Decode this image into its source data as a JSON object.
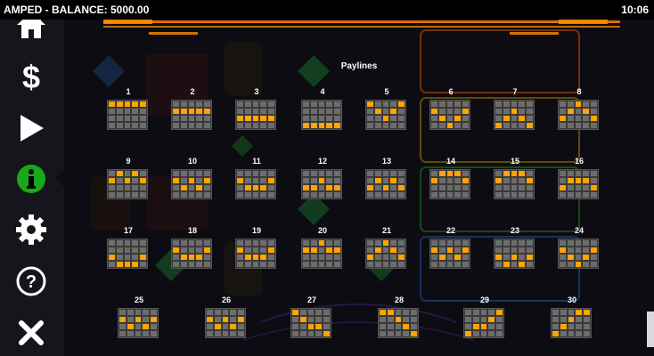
{
  "topbar": {
    "title": "AMPED - BALANCE: 5000.00",
    "clock": "10:06"
  },
  "sidebar": {
    "items": [
      {
        "icon": "home-icon",
        "active": false
      },
      {
        "icon": "dollar-icon",
        "active": false
      },
      {
        "icon": "play-icon",
        "active": false
      },
      {
        "icon": "info-icon",
        "active": true
      },
      {
        "icon": "gear-icon",
        "active": false
      },
      {
        "icon": "help-icon",
        "active": false
      },
      {
        "icon": "close-icon",
        "active": false
      }
    ],
    "active_color": "#19a81a"
  },
  "paytable": {
    "title": "Paylines",
    "grid_rows": 4,
    "grid_cols": 5,
    "paylines": [
      {
        "n": "1",
        "rows": [
          0,
          0,
          0,
          0,
          0
        ]
      },
      {
        "n": "2",
        "rows": [
          1,
          1,
          1,
          1,
          1
        ]
      },
      {
        "n": "3",
        "rows": [
          2,
          2,
          2,
          2,
          2
        ]
      },
      {
        "n": "4",
        "rows": [
          3,
          3,
          3,
          3,
          3
        ]
      },
      {
        "n": "5",
        "rows": [
          0,
          1,
          2,
          1,
          0
        ]
      },
      {
        "n": "6",
        "rows": [
          1,
          2,
          3,
          2,
          1
        ]
      },
      {
        "n": "7",
        "rows": [
          3,
          2,
          1,
          2,
          3
        ]
      },
      {
        "n": "8",
        "rows": [
          2,
          1,
          0,
          1,
          2
        ]
      },
      {
        "n": "9",
        "rows": [
          1,
          0,
          1,
          0,
          1
        ]
      },
      {
        "n": "10",
        "rows": [
          1,
          2,
          1,
          2,
          1
        ]
      },
      {
        "n": "11",
        "rows": [
          1,
          2,
          2,
          2,
          1
        ]
      },
      {
        "n": "12",
        "rows": [
          2,
          2,
          1,
          2,
          2
        ]
      },
      {
        "n": "13",
        "rows": [
          2,
          1,
          2,
          1,
          2
        ]
      },
      {
        "n": "14",
        "rows": [
          1,
          0,
          0,
          0,
          1
        ]
      },
      {
        "n": "15",
        "rows": [
          1,
          0,
          0,
          0,
          1
        ]
      },
      {
        "n": "16",
        "rows": [
          2,
          1,
          1,
          1,
          2
        ]
      },
      {
        "n": "17",
        "rows": [
          2,
          3,
          3,
          3,
          2
        ]
      },
      {
        "n": "18",
        "rows": [
          1,
          2,
          2,
          2,
          1
        ]
      },
      {
        "n": "19",
        "rows": [
          1,
          2,
          2,
          2,
          1
        ]
      },
      {
        "n": "20",
        "rows": [
          1,
          1,
          0,
          1,
          1
        ]
      },
      {
        "n": "21",
        "rows": [
          2,
          1,
          0,
          1,
          2
        ]
      },
      {
        "n": "22",
        "rows": [
          1,
          2,
          1,
          2,
          1
        ]
      },
      {
        "n": "23",
        "rows": [
          2,
          3,
          2,
          3,
          2
        ]
      },
      {
        "n": "24",
        "rows": [
          1,
          2,
          3,
          2,
          1
        ]
      },
      {
        "n": "25",
        "rows": [
          1,
          2,
          1,
          2,
          1
        ]
      },
      {
        "n": "26",
        "rows": [
          1,
          2,
          1,
          2,
          1
        ]
      },
      {
        "n": "27",
        "rows": [
          0,
          1,
          2,
          2,
          3
        ]
      },
      {
        "n": "28",
        "rows": [
          0,
          0,
          1,
          2,
          3
        ]
      },
      {
        "n": "29",
        "rows": [
          3,
          2,
          2,
          1,
          0
        ]
      },
      {
        "n": "30",
        "rows": [
          3,
          2,
          1,
          0,
          0
        ]
      }
    ]
  },
  "colors": {
    "lit": "#ffa400",
    "unlit": "#6d6d6d",
    "grid_bg": "#3a3a3a"
  }
}
